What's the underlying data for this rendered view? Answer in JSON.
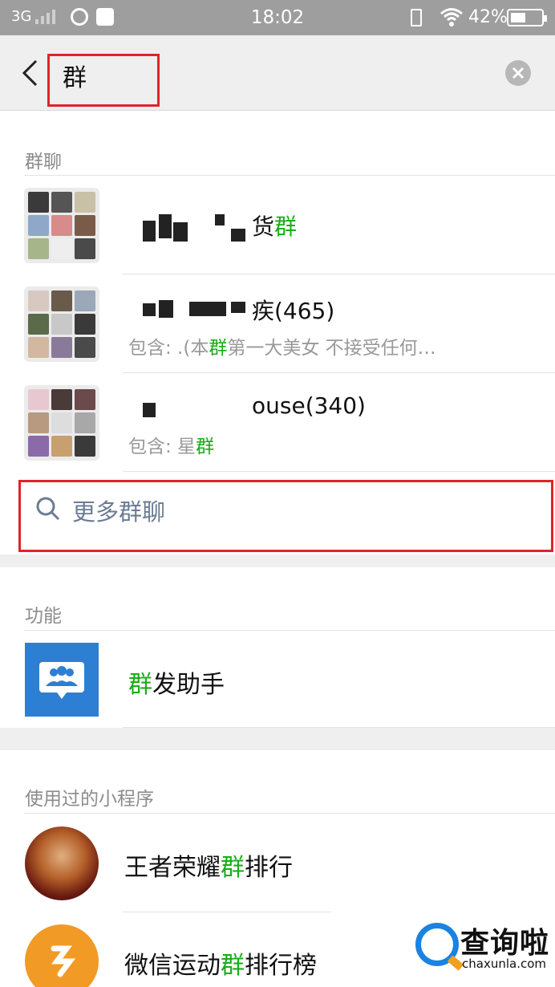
{
  "status_bar": {
    "network": "3G",
    "time": "18:02",
    "battery": "42%"
  },
  "search": {
    "query": "群"
  },
  "sections": {
    "group_chats": "群聊",
    "functions": "功能",
    "mini_programs": "使用过的小程序"
  },
  "groups": [
    {
      "title_visible": "货",
      "title_highlight": "群",
      "title_tail": "",
      "sub_prefix": "",
      "sub_highlight": "",
      "sub_tail": ""
    },
    {
      "title_visible": "疾(465)",
      "title_highlight": "",
      "title_tail": "",
      "sub_prefix": "包含: .(本",
      "sub_highlight": "群",
      "sub_tail": "第一大美女 不接受任何…"
    },
    {
      "title_visible": "ouse(340)",
      "title_highlight": "",
      "title_tail": "",
      "sub_prefix": "包含: 星",
      "sub_highlight": "群",
      "sub_tail": ""
    }
  ],
  "more_groups": "更多群聊",
  "function_item": {
    "highlight": "群",
    "rest": "发助手"
  },
  "mini_programs": [
    {
      "prefix": "王者荣耀",
      "highlight": "群",
      "suffix": "排行"
    },
    {
      "prefix": "微信运动",
      "highlight": "群",
      "suffix": "排行榜"
    }
  ],
  "watermark": {
    "cn": "查询啦",
    "en": "chaxunla.com"
  },
  "colors": {
    "highlight": "#1aad19",
    "annotation_red": "#e0242a",
    "link": "#6b7b93"
  }
}
